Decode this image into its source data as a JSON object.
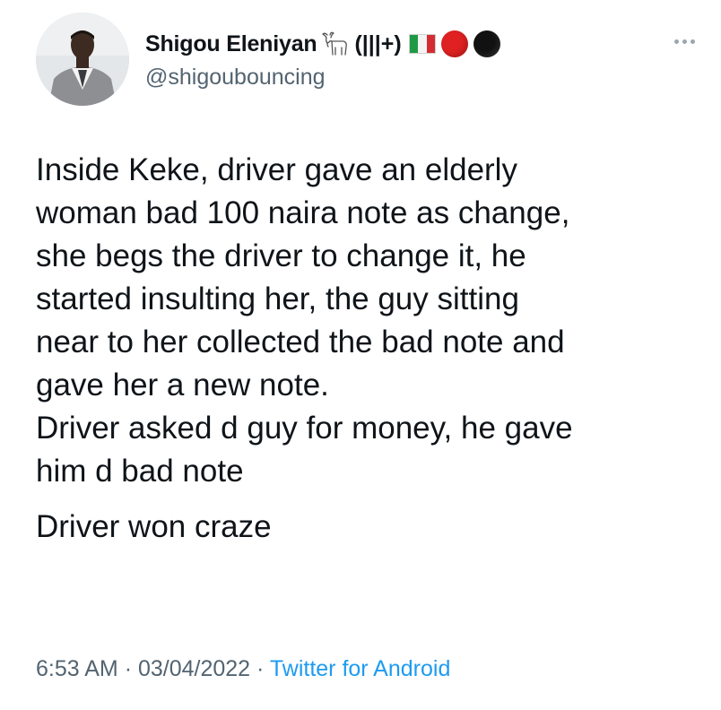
{
  "author": {
    "display_name": "Shigou Eleniyan",
    "name_suffix": "(|||+)",
    "name_emojis": [
      "goat-icon",
      "italy-flag-icon",
      "red-circle-icon",
      "black-circle-icon"
    ],
    "handle": "@shigoubouncing"
  },
  "tweet": {
    "paragraph1_lines": [
      "Inside Keke, driver gave an elderly",
      "woman bad 100 naira note as change,",
      "she begs the driver to change it, he",
      "started insulting her, the guy sitting",
      "near to her collected the bad note and",
      "gave her a new note.",
      "Driver asked d guy for money, he gave",
      "him d bad note"
    ],
    "paragraph2_lines": [
      "Driver won craze"
    ]
  },
  "meta": {
    "time": "6:53 AM",
    "separator": "·",
    "date": "03/04/2022",
    "source": "Twitter for Android"
  },
  "colors": {
    "text": "#0f1419",
    "secondary": "#536471",
    "link": "#1d9bf0"
  }
}
